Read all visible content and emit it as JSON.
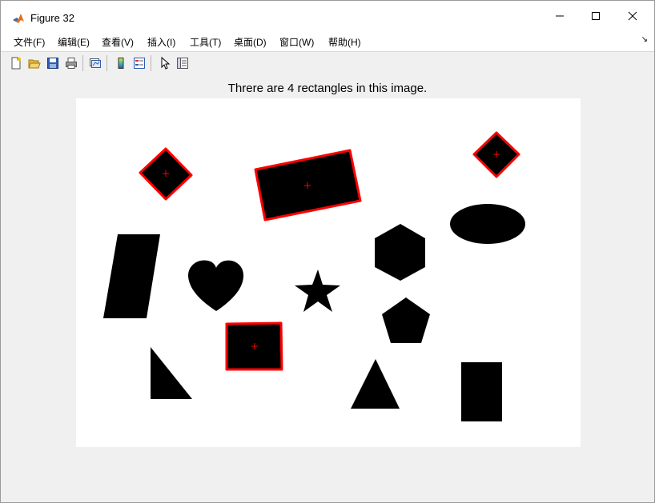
{
  "window": {
    "title": "Figure 32",
    "controls": [
      "minimize",
      "maximize",
      "close"
    ]
  },
  "menu": {
    "items": [
      "文件(F)",
      "编辑(E)",
      "查看(V)",
      "插入(I)",
      "工具(T)",
      "桌面(D)",
      "窗口(W)",
      "帮助(H)"
    ]
  },
  "toolbar": {
    "buttons": [
      "new-figure-icon",
      "open-file-icon",
      "save-icon",
      "print-icon",
      "link-plot-icon",
      "insert-colorbar-icon",
      "insert-legend-icon",
      "edit-plot-icon",
      "property-inspector-icon"
    ]
  },
  "figure": {
    "title": "Threre are 4 rectangles in this image.",
    "detected_count": 4,
    "highlight_color": "#ff0000",
    "shape_color": "#000000"
  }
}
